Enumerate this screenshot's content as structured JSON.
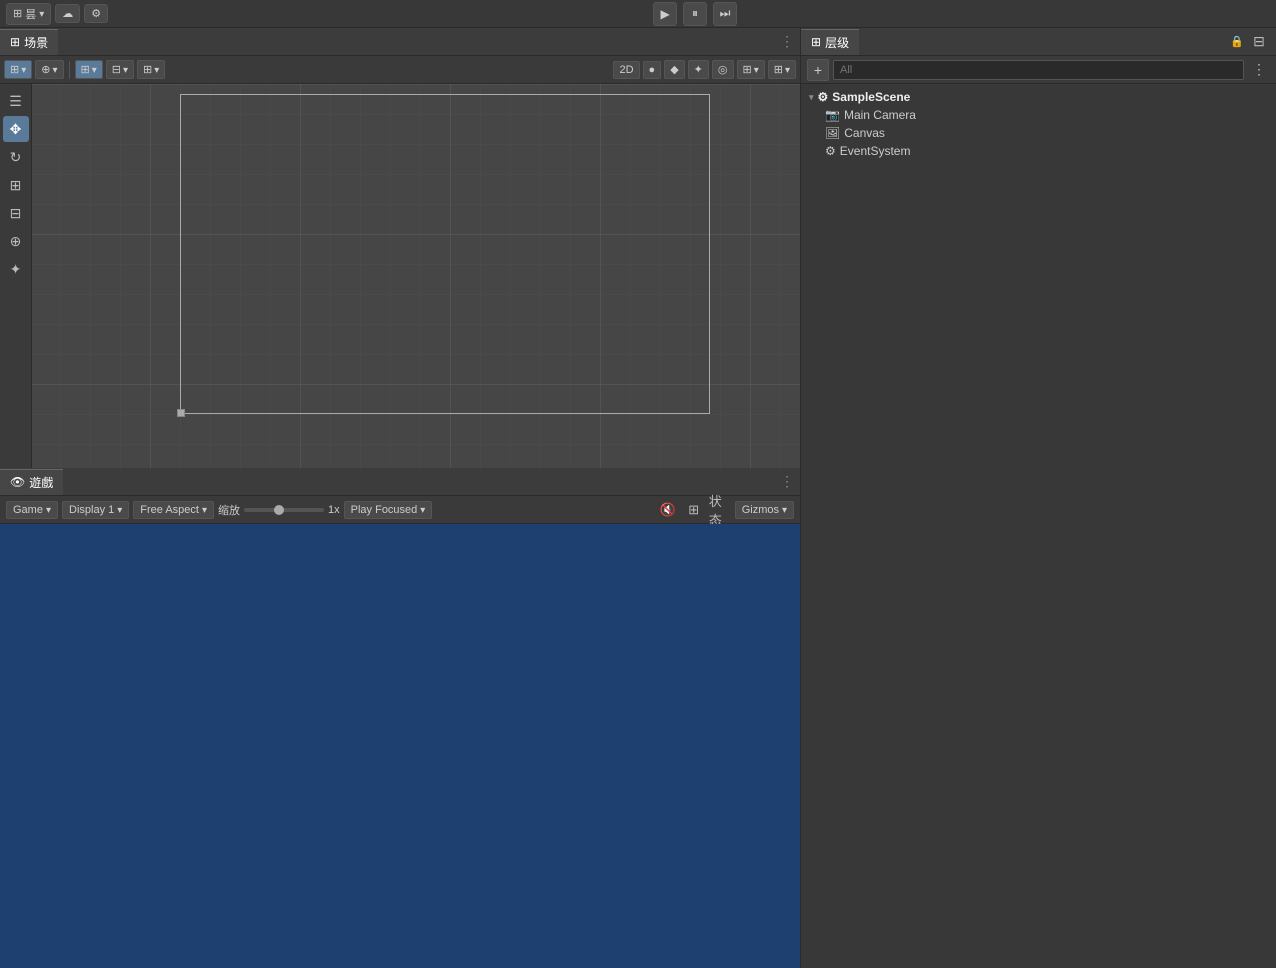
{
  "topbar": {
    "mode_label": "昙",
    "cloud_label": "☁",
    "settings_label": "⚙",
    "play_icon": "▶",
    "pause_icon": "⏸",
    "step_icon": "⏭"
  },
  "scene": {
    "tab_label": "场景",
    "tab_icon": "⊞",
    "toolbar": {
      "grid_btn": "⊞",
      "globe_btn": "⊕",
      "transform_btn": "⊞",
      "rect_btn": "⊟",
      "grid2_btn": "⊞",
      "persp_btn": "2D",
      "light_btn": "●",
      "audio_btn": "◆",
      "fx_btn": "◈",
      "hide_btn": "◎",
      "display_btn": "⊞",
      "gizmos_btn": "⊞"
    }
  },
  "game": {
    "tab_label": "遊戲",
    "tab_icon": "👁",
    "toolbar": {
      "game_label": "Game",
      "display_label": "Display 1",
      "aspect_label": "Free Aspect",
      "scale_label": "缩放",
      "scale_value": "1x",
      "play_focused_label": "Play Focused",
      "mute_icon": "🔇",
      "stats_icon": "⊞",
      "status_label": "状态",
      "gizmos_label": "Gizmos"
    }
  },
  "hierarchy": {
    "tab_label": "层级",
    "tab_icon": "⊞",
    "search_placeholder": "All",
    "add_btn": "+",
    "scene": {
      "name": "SampleScene",
      "items": [
        {
          "name": "Main Camera",
          "icon": "📷",
          "indent": 1
        },
        {
          "name": "Canvas",
          "icon": "🖼",
          "indent": 1
        },
        {
          "name": "EventSystem",
          "icon": "⚙",
          "indent": 1
        }
      ]
    }
  },
  "tools": {
    "hand": "✋",
    "move": "✥",
    "rotate": "↻",
    "scale": "⊞",
    "rect": "⊟",
    "transform": "⊞",
    "custom": "⊕"
  }
}
